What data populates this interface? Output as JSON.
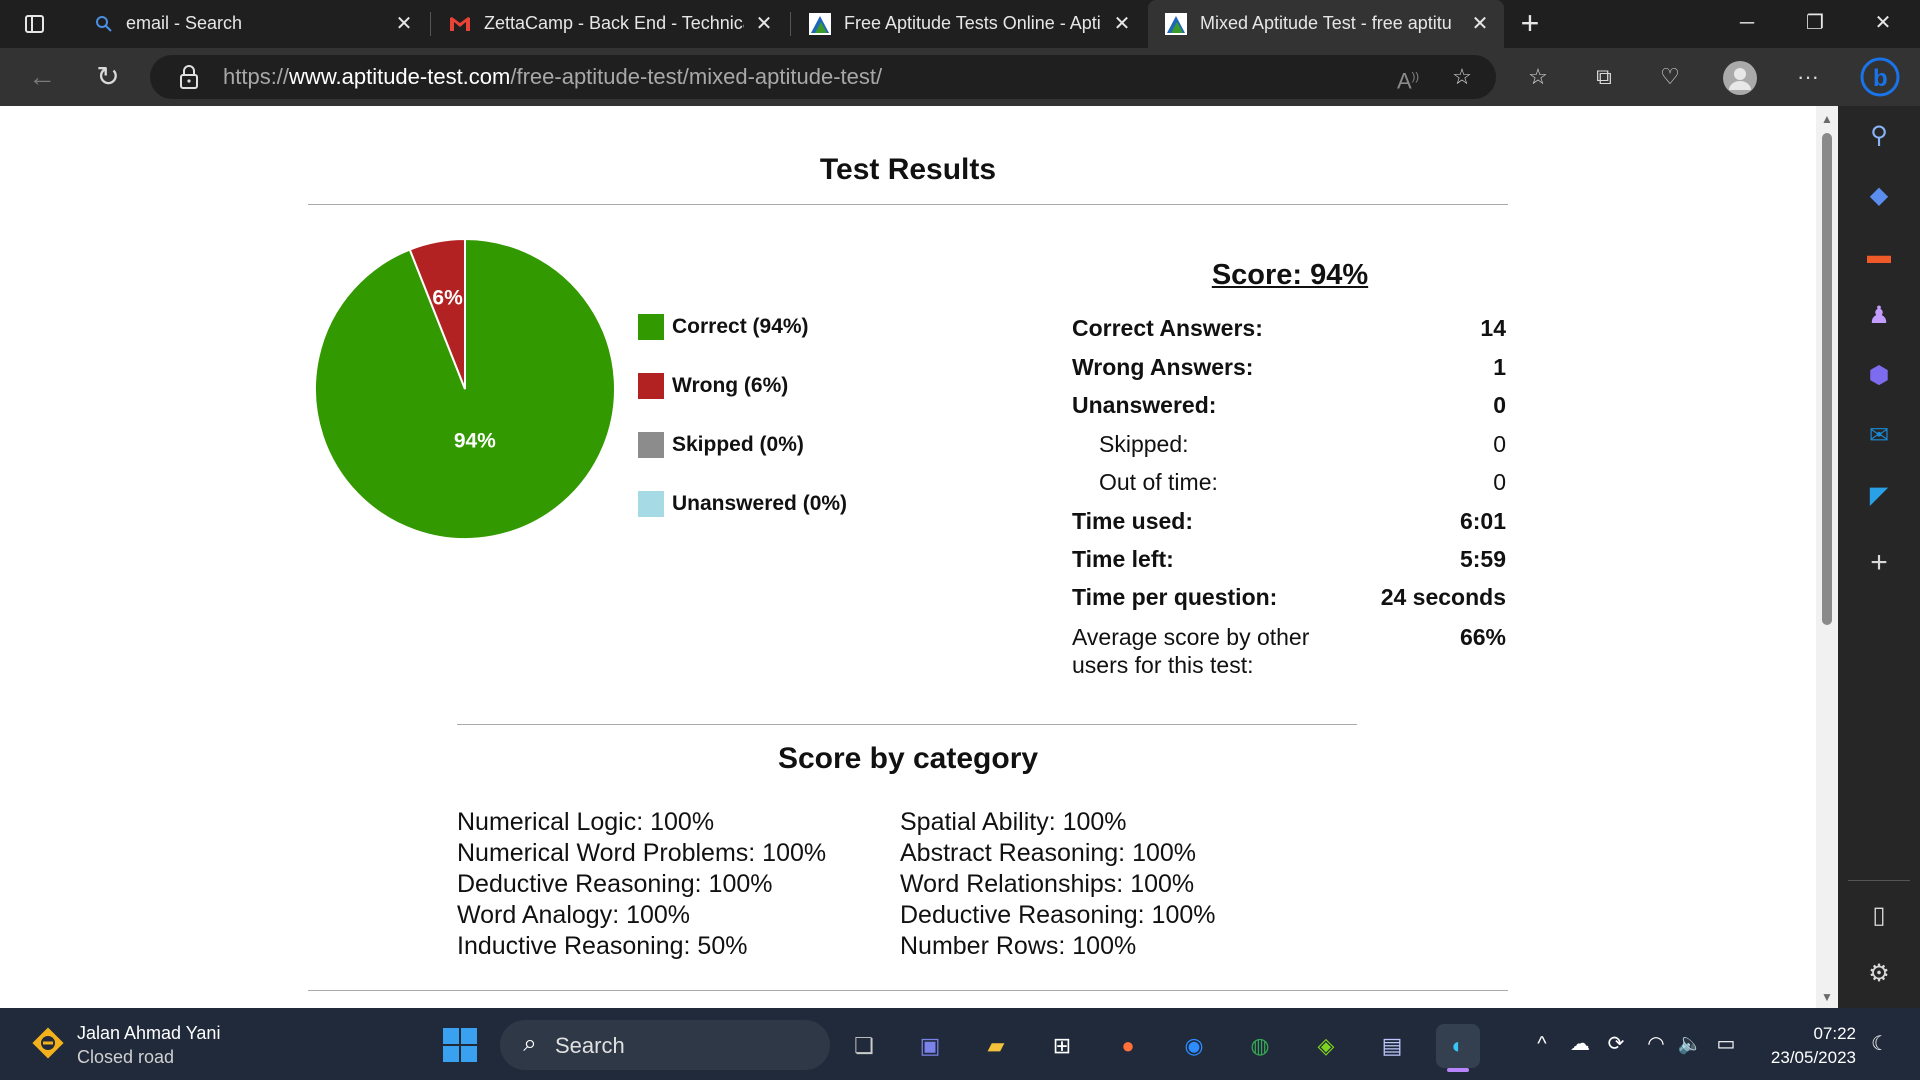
{
  "tabs": [
    {
      "title": "email - Search",
      "icon": "search-icon"
    },
    {
      "title": "ZettaCamp - Back End - Technica",
      "icon": "gmail-icon"
    },
    {
      "title": "Free Aptitude Tests Online - Apti",
      "icon": "aptitude-test-icon"
    },
    {
      "title": "Mixed Aptitude Test - free aptitu",
      "icon": "aptitude-test-icon",
      "active": true
    }
  ],
  "address": {
    "scheme": "https://",
    "host": "www.aptitude-test.com",
    "path": "/free-aptitude-test/mixed-aptitude-test/"
  },
  "results": {
    "title": "Test Results",
    "score": "Score: 94%",
    "stats": [
      {
        "label": "Correct Answers:",
        "value": "14",
        "bold": true
      },
      {
        "label": "Wrong Answers:",
        "value": "1",
        "bold": true
      },
      {
        "label": "Unanswered:",
        "value": "0",
        "bold": true
      },
      {
        "label": "Skipped:",
        "value": "0",
        "bold": false,
        "indent": true
      },
      {
        "label": "Out of time:",
        "value": "0",
        "bold": false,
        "indent": true
      },
      {
        "label": "Time used:",
        "value": "6:01",
        "bold": true
      },
      {
        "label": "Time left:",
        "value": "5:59",
        "bold": true
      },
      {
        "label": "Time per question:",
        "value": "24 seconds",
        "bold": true
      }
    ],
    "average_label_line1": "Average score by other",
    "average_label_line2": "users for this test:",
    "average_value": "66%"
  },
  "chart_data": {
    "type": "pie",
    "categories": [
      "Correct (94%)",
      "Wrong (6%)",
      "Skipped (0%)",
      "Unanswered (0%)"
    ],
    "values": [
      94,
      6,
      0,
      0
    ],
    "colors": [
      "#339900",
      "#b22222",
      "#8c8c8c",
      "#a6dbe6"
    ],
    "slice_labels": [
      "94%",
      "6%",
      "",
      ""
    ],
    "legend_position": "right"
  },
  "categories": {
    "title": "Score by category",
    "left": [
      "Numerical Logic: 100%",
      "Numerical Word Problems: 100%",
      "Deductive Reasoning: 100%",
      "Word Analogy: 100%",
      "Inductive Reasoning: 50%"
    ],
    "right": [
      "Spatial Ability: 100%",
      "Abstract Reasoning: 100%",
      "Word Relationships: 100%",
      "Deductive Reasoning: 100%",
      "Number Rows: 100%"
    ]
  },
  "taskbar": {
    "weather_title": "Jalan Ahmad Yani",
    "weather_sub": "Closed road",
    "search_placeholder": "Search",
    "time": "07:22",
    "date": "23/05/2023"
  }
}
